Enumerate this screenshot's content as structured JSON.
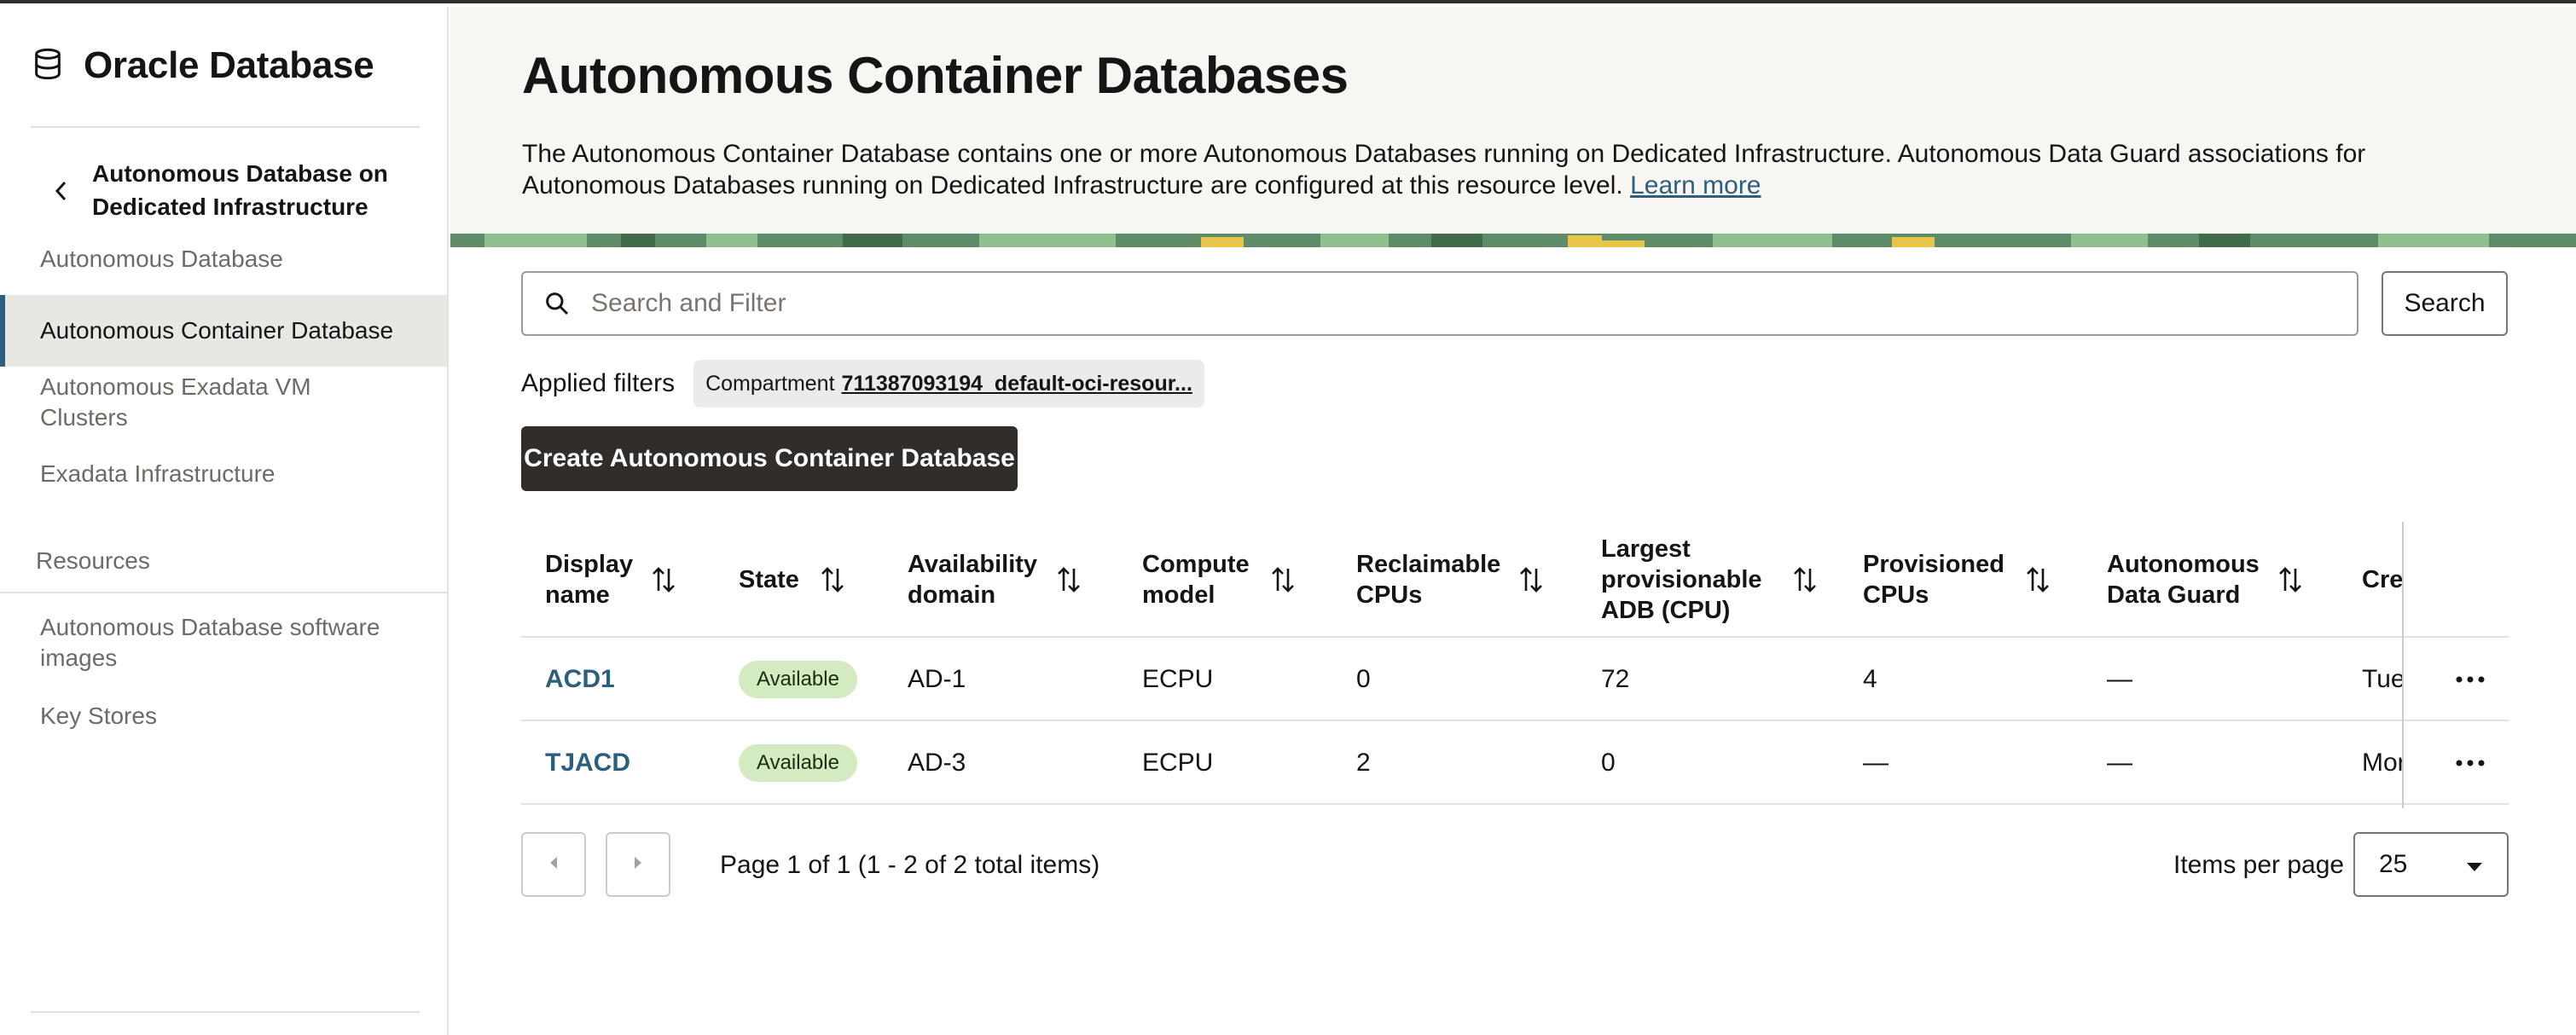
{
  "sidebar": {
    "brand": "Oracle Database",
    "back_label": "Autonomous Database on Dedicated Infrastructure",
    "items": [
      {
        "label": "Autonomous Database"
      },
      {
        "label": "Autonomous Container Database"
      },
      {
        "label": "Autonomous Exadata VM Clusters"
      },
      {
        "label": "Exadata Infrastructure"
      }
    ],
    "resources_heading": "Resources",
    "resources": [
      {
        "label": "Autonomous Database software images"
      },
      {
        "label": "Key Stores"
      }
    ],
    "active_item": "Autonomous Container Database"
  },
  "header": {
    "title": "Autonomous Container Databases",
    "description": "The Autonomous Container Database contains one or more Autonomous Databases running on Dedicated Infrastructure. Autonomous Data Guard associations for Autonomous Databases running on Dedicated Infrastructure are configured at this resource level.",
    "learn_more": "Learn more"
  },
  "search": {
    "placeholder": "Search and Filter",
    "button_label": "Search"
  },
  "filters": {
    "label": "Applied filters",
    "chip_key": "Compartment",
    "chip_value": "711387093194_default-oci-resour..."
  },
  "create_button": "Create Autonomous Container Database",
  "table": {
    "columns": [
      "Display name",
      "State",
      "Availability domain",
      "Compute model",
      "Reclaimable CPUs",
      "Largest provisionable ADB (CPU)",
      "Provisioned CPUs",
      "Autonomous Data Guard",
      "Crea"
    ],
    "rows": [
      {
        "name": "ACD1",
        "state": "Available",
        "ad": "AD-1",
        "compute": "ECPU",
        "reclaimable": "0",
        "largest": "72",
        "provisioned": "4",
        "data_guard": "—",
        "created": "Tue"
      },
      {
        "name": "TJACD",
        "state": "Available",
        "ad": "AD-3",
        "compute": "ECPU",
        "reclaimable": "2",
        "largest": "0",
        "provisioned": "—",
        "data_guard": "—",
        "created": "Mor"
      }
    ]
  },
  "pagination": {
    "text": "Page 1 of 1 (1 - 2 of 2 total items)",
    "items_per_page_label": "Items per page",
    "items_per_page": "25"
  },
  "colors": {
    "accent": "#2c5e7e",
    "primary_button": "#312d2a",
    "badge_bg": "#d4ebc1",
    "header_bg": "#f8f6f3"
  }
}
